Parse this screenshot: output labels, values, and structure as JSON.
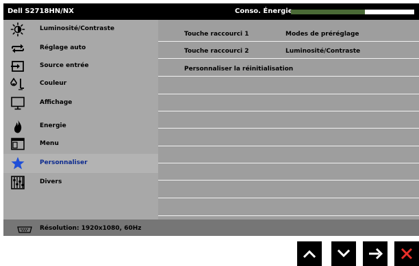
{
  "header": {
    "title": "Dell S2718HN/NX",
    "energy_label": "Conso. Énergie",
    "energy_level": 0.6
  },
  "sidebar": {
    "items": [
      {
        "label": "Luminosité/Contraste",
        "icon": "brightness-icon"
      },
      {
        "label": "Réglage auto",
        "icon": "auto-adjust-icon"
      },
      {
        "label": "Source entrée",
        "icon": "input-source-icon"
      },
      {
        "label": "Couleur",
        "icon": "color-icon"
      },
      {
        "label": "Affichage",
        "icon": "display-icon"
      },
      {
        "label": "Energie",
        "icon": "energy-icon"
      },
      {
        "label": "Menu",
        "icon": "menu-icon"
      },
      {
        "label": "Personnaliser",
        "icon": "star-icon",
        "selected": true
      },
      {
        "label": "Divers",
        "icon": "sliders-icon"
      }
    ]
  },
  "content": {
    "rows": [
      {
        "key": "Touche raccourci 1",
        "value": "Modes de préréglage"
      },
      {
        "key": "Touche raccourci 2",
        "value": "Luminosité/Contraste"
      },
      {
        "key": "Personnaliser la réinitialisation",
        "value": ""
      }
    ]
  },
  "footer": {
    "resolution": "Résolution: 1920x1080, 60Hz",
    "icon": "vga-connector-icon"
  },
  "controls": [
    {
      "icon": "chevron-up-icon",
      "color": "#ffffff"
    },
    {
      "icon": "chevron-down-icon",
      "color": "#ffffff"
    },
    {
      "icon": "arrow-right-icon",
      "color": "#ffffff"
    },
    {
      "icon": "close-icon",
      "color": "#e8302a"
    }
  ],
  "colors": {
    "title_bar": "#000000",
    "panel": "#9e9e9e",
    "sidebar": "#a8a8a8",
    "selected_row": "#b3b3b3",
    "selected_text": "#0d2b8f",
    "selected_icon": "#1f4fd8",
    "energy_fill": "#4a6a36",
    "footer": "#767676"
  }
}
